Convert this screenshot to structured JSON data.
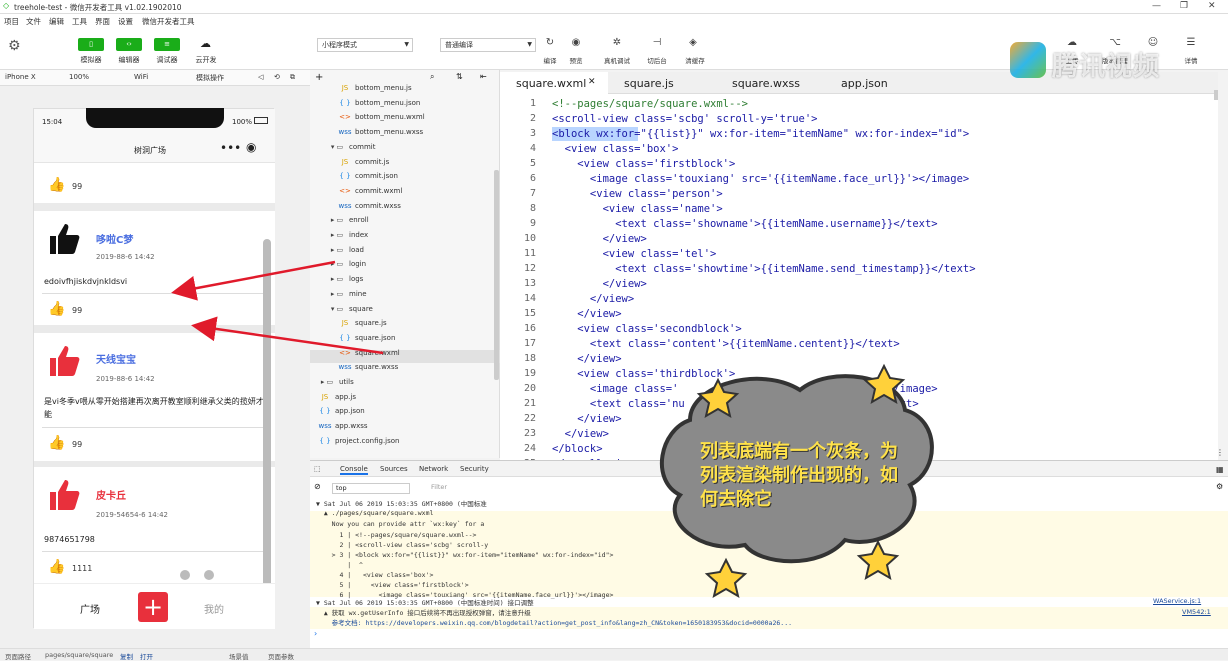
{
  "window": {
    "title": "treehole-test - 微信开发者工具 v1.02.1902010"
  },
  "menu": [
    "项目",
    "文件",
    "编辑",
    "工具",
    "界面",
    "设置",
    "微信开发者工具"
  ],
  "toolbar": {
    "buttons": [
      {
        "label": "模拟器"
      },
      {
        "label": "编辑器"
      },
      {
        "label": "调试器"
      },
      {
        "label": "云开发"
      }
    ],
    "mode_select": "小程序模式",
    "compile_select": "普通编译",
    "actions": [
      "编译",
      "预览",
      "真机调试",
      "切后台",
      "清缓存"
    ],
    "right_actions": [
      "上传",
      "版本管理",
      "详情"
    ]
  },
  "devbar": {
    "device": "iPhone X",
    "zoom": "100%",
    "network": "WiFi",
    "op": "模拟操作"
  },
  "phone": {
    "time": "15:04",
    "battery": "100%",
    "nav_title": "树洞广场",
    "cards": [
      {
        "count": "99"
      },
      {
        "name": "哆啦C梦",
        "date": "2019-88-6 14:42",
        "content": "edoivfhjiskdvjnkldsvi",
        "count": "99",
        "icon_color": "#111111"
      },
      {
        "name": "天线宝宝",
        "date": "2019-88-6 14:42",
        "content": "是vi冬季v喂从零开始搭建再次离开教室顺利继承父类的揽妍才能",
        "count": "99",
        "icon_color": "#e8303c"
      },
      {
        "name": "皮卡丘",
        "date": "2019-54654-6 14:42",
        "content": "9874651798",
        "count": "1111",
        "icon_color": "#e8303c"
      }
    ],
    "tabbar": {
      "left": "广场",
      "right": "我的",
      "add_icon": "plus-icon"
    }
  },
  "filetree": [
    {
      "name": "bottom_menu.js",
      "type": "js",
      "indent": 2
    },
    {
      "name": "bottom_menu.json",
      "type": "json",
      "indent": 2
    },
    {
      "name": "bottom_menu.wxml",
      "type": "wxml",
      "indent": 2
    },
    {
      "name": "bottom_menu.wxss",
      "type": "wxss",
      "indent": 2
    },
    {
      "name": "commit",
      "type": "folder-open",
      "indent": 1
    },
    {
      "name": "commit.js",
      "type": "js",
      "indent": 2
    },
    {
      "name": "commit.json",
      "type": "json",
      "indent": 2
    },
    {
      "name": "commit.wxml",
      "type": "wxml",
      "indent": 2
    },
    {
      "name": "commit.wxss",
      "type": "wxss",
      "indent": 2
    },
    {
      "name": "enroll",
      "type": "folder",
      "indent": 1
    },
    {
      "name": "index",
      "type": "folder",
      "indent": 1
    },
    {
      "name": "load",
      "type": "folder",
      "indent": 1
    },
    {
      "name": "login",
      "type": "folder",
      "indent": 1
    },
    {
      "name": "logs",
      "type": "folder",
      "indent": 1
    },
    {
      "name": "mine",
      "type": "folder",
      "indent": 1
    },
    {
      "name": "square",
      "type": "folder-open",
      "indent": 1
    },
    {
      "name": "square.js",
      "type": "js",
      "indent": 2
    },
    {
      "name": "square.json",
      "type": "json",
      "indent": 2
    },
    {
      "name": "square.wxml",
      "type": "wxml",
      "indent": 2,
      "selected": true
    },
    {
      "name": "square.wxss",
      "type": "wxss",
      "indent": 2
    },
    {
      "name": "utils",
      "type": "folder",
      "indent": 0
    },
    {
      "name": "app.js",
      "type": "js",
      "indent": 0
    },
    {
      "name": "app.json",
      "type": "json",
      "indent": 0
    },
    {
      "name": "app.wxss",
      "type": "wxss",
      "indent": 0
    },
    {
      "name": "project.config.json",
      "type": "json",
      "indent": 0
    }
  ],
  "editor": {
    "tabs": [
      "square.wxml",
      "square.js",
      "square.wxss",
      "app.json"
    ],
    "lines": [
      "<!--pages/square/square.wxml-->",
      "<scroll-view class='scbg' scroll-y='true'>",
      "<block wx:for=\"{{list}}\" wx:for-item=\"itemName\" wx:for-index=\"id\">",
      "  <view class='box'>",
      "    <view class='firstblock'>",
      "      <image class='touxiang' src='{{itemName.face_url}}'></image>",
      "      <view class='person'>",
      "        <view class='name'>",
      "          <text class='showname'>{{itemName.username}}</text>",
      "        </view>",
      "        <view class='tel'>",
      "          <text class='showtime'>{{itemName.send_timestamp}}</text>",
      "        </view>",
      "      </view>",
      "    </view>",
      "    <view class='secondblock'>",
      "      <text class='content'>{{itemName.centent}}</text>",
      "    </view>",
      "    <view class='thirdblock'>",
      "      <image class='          src=              png'></image>",
      "      <text class='nu                               /text>",
      "    </view>",
      "  </view>",
      "</block>",
      "</scroll-view>",
      "",
      "<include src=\"/pa"
    ]
  },
  "console": {
    "tabs": [
      "Console",
      "Sources",
      "Network",
      "Security"
    ],
    "context": "top",
    "filter": "Filter",
    "lines": [
      "▼ Sat Jul 06 2019 15:03:35 GMT+0800 (中国标准",
      "  ▲ ./pages/square/square.wxml",
      "    Now you can provide attr `wx:key` for a",
      "      1 | <!--pages/square/square.wxml-->",
      "      2 | <scroll-view class='scbg' scroll-y",
      "    > 3 | <block wx:for=\"{{list}}\" wx:for-item=\"itemName\" wx:for-index=\"id\">",
      "        |  ^",
      "      4 |   <view class='box'>",
      "      5 |     <view class='firstblock'>",
      "      6 |       <image class='touxiang' src='{{itemName.face_url}}'></image>",
      "▼ Sat Jul 06 2019 15:03:35 GMT+0800 (中国标准时间) 接口调整",
      "  ▲ 获取 wx.getUserInfo 接口后续将不再出现授权弹窗，请注意升级",
      "    参考文档: https://developers.weixin.qq.com/blogdetail?action=get_post_info&lang=zh_CN&token=1650183953&docid=0000a26..."
    ],
    "refs": [
      "WAService.js:1",
      "VM542:1"
    ]
  },
  "status": {
    "path_label": "页面路径",
    "path": "pages/square/square",
    "copy": "复制",
    "open": "打开",
    "scene": "场景值",
    "params": "页面参数"
  },
  "annotation": {
    "bubble_text": "列表底端有一个灰条，为列表渲染制作出现的，如何去除它"
  },
  "watermark": {
    "text": "腾讯视频"
  }
}
